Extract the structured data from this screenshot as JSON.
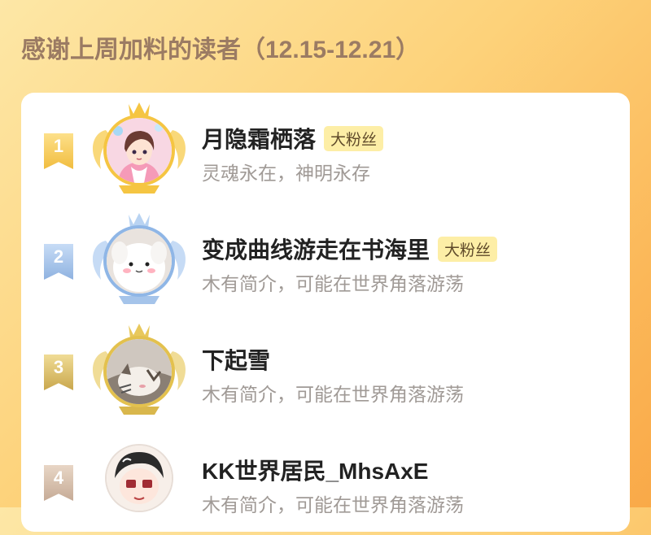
{
  "page": {
    "title": "感谢上周加料的读者（12.15-12.21）",
    "title_color": "#9b7b63",
    "background": "#fdd27a"
  },
  "readers": [
    {
      "rank": "1",
      "name": "月隐霜栖落",
      "badge": "大粉丝",
      "bio": "灵魂永在，神明永存",
      "frame": "gold",
      "avatar_icon": "anime-boy-avatar"
    },
    {
      "rank": "2",
      "name": "变成曲线游走在书海里",
      "badge": "大粉丝",
      "bio": "木有简介，可能在世界角落游荡",
      "frame": "silver",
      "avatar_icon": "white-puppy-avatar"
    },
    {
      "rank": "3",
      "name": "下起雪",
      "bio": "木有简介，可能在世界角落游荡",
      "frame": "bronze",
      "avatar_icon": "tabby-cat-avatar"
    },
    {
      "rank": "4",
      "name": "KK世界居民_MhsAxE",
      "bio": "木有简介，可能在世界角落游荡",
      "frame": "none",
      "avatar_icon": "chibi-character-avatar"
    }
  ],
  "colors": {
    "gold": "#f5c542",
    "silver": "#8fb6e6",
    "bronze": "#e3c14e",
    "badge_bg": "#fdeea6",
    "bio_text": "#a09a96"
  }
}
